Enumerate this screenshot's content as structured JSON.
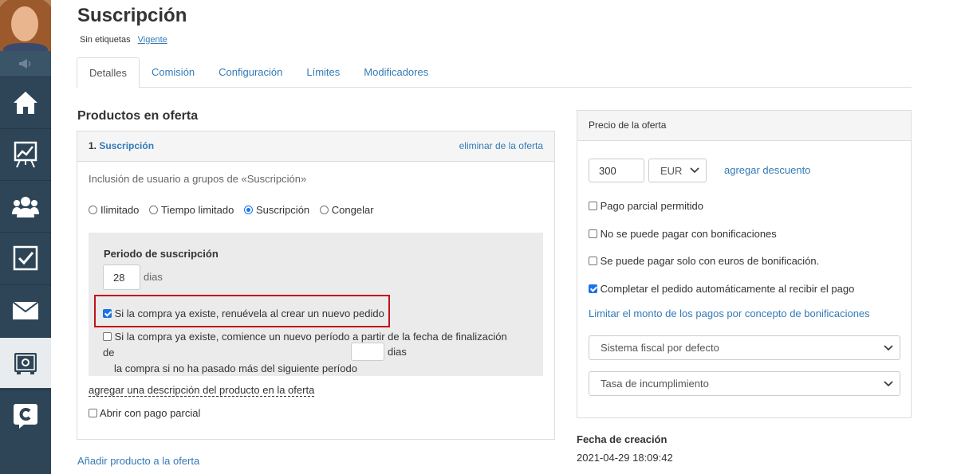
{
  "sidebar": {
    "items": [
      {
        "icon": "home-icon"
      },
      {
        "icon": "chart-board-icon"
      },
      {
        "icon": "users-icon"
      },
      {
        "icon": "checkbox-icon"
      },
      {
        "icon": "mail-icon"
      },
      {
        "icon": "safe-icon"
      },
      {
        "icon": "chat-c-icon"
      }
    ]
  },
  "header": {
    "title": "Suscripción",
    "tags_label": "Sin etiquetas",
    "status": "Vigente"
  },
  "tabs": [
    "Detalles",
    "Comisión",
    "Configuración",
    "Límites",
    "Modificadores"
  ],
  "products": {
    "section_title": "Productos en oferta",
    "offer_number": "1.",
    "offer_name": "Suscripción",
    "remove_label": "eliminar de la oferta",
    "group_inclusion": "Inclusión de usuario a grupos de «Suscripción»",
    "access_options": [
      "Ilimitado",
      "Tiempo limitado",
      "Suscripción",
      "Congelar"
    ],
    "access_selected": "Suscripción",
    "period_title": "Periodo de suscripción",
    "period_value": "28",
    "period_unit": "dias",
    "renew_label": "Si la compra ya existe, renuévela al crear un nuevo pedido",
    "renew_checked": true,
    "new_period_line1": "Si la compra ya existe, comience un nuevo período a partir de la fecha de finalización de",
    "new_period_line2": "la compra si no ha pasado más del siguiente período",
    "new_period_value": "",
    "new_period_unit": "dias",
    "new_period_checked": false,
    "add_description": "agregar una descripción del producto en la oferta",
    "partial_open_label": "Abrir con pago parcial",
    "add_product": "Añadir producto a la oferta"
  },
  "price": {
    "header": "Precio de la oferta",
    "amount": "300",
    "currency": "EUR",
    "add_discount": "agregar descuento",
    "options": [
      {
        "label": "Pago parcial permitido",
        "checked": false
      },
      {
        "label": "No se puede pagar con bonificaciones",
        "checked": false
      },
      {
        "label": "Se puede pagar solo con euros de bonificación.",
        "checked": false
      },
      {
        "label": "Completar el pedido automáticamente al recibir el pago",
        "checked": true
      }
    ],
    "limit_link": "Limitar el monto de los pagos por concepto de bonificaciones",
    "tax_select": "Sistema fiscal por defecto",
    "default_rate_select": "Tasa de incumplimiento"
  },
  "creation": {
    "label": "Fecha de creación",
    "date": "2021-04-29 18:09:42"
  },
  "colors": {
    "sidebar": "#2e4457",
    "link": "#337ab7",
    "highlight": "#c0131b",
    "checkbox": "#1a73e8"
  }
}
